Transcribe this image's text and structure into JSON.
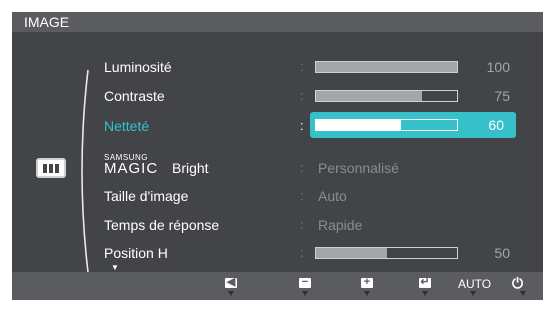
{
  "osd": {
    "title": "IMAGE",
    "menu": [
      {
        "label": "Luminosité",
        "kind": "bar",
        "value": 100
      },
      {
        "label": "Contraste",
        "kind": "bar",
        "value": 75
      },
      {
        "label": "Netteté",
        "kind": "bar",
        "value": 60,
        "selected": true
      },
      {
        "label_brand_small": "SAMSUNG",
        "label_brand_big": "MAGIC",
        "label_suffix": "Bright",
        "kind": "text",
        "value": "Personnalisé"
      },
      {
        "label": "Taille d'image",
        "kind": "text",
        "value": "Auto"
      },
      {
        "label": "Temps de réponse",
        "kind": "text",
        "value": "Rapide"
      },
      {
        "label": "Position H",
        "kind": "bar",
        "value": 50
      }
    ],
    "separator": ":",
    "scroll_down_icon": "triangle-down-icon",
    "side_icon": "picture-menu-icon",
    "buttons": [
      {
        "icon": "left-arrow-icon",
        "glyph": "◀"
      },
      {
        "icon": "minus-icon",
        "glyph": "−"
      },
      {
        "icon": "plus-icon",
        "glyph": "+"
      },
      {
        "icon": "enter-icon",
        "glyph": "↵"
      },
      {
        "label": "AUTO"
      },
      {
        "icon": "power-icon",
        "glyph": "⏻"
      }
    ],
    "colors": {
      "background": "#424448",
      "bar": "#5a5c60",
      "accent": "#36c0ca"
    }
  }
}
